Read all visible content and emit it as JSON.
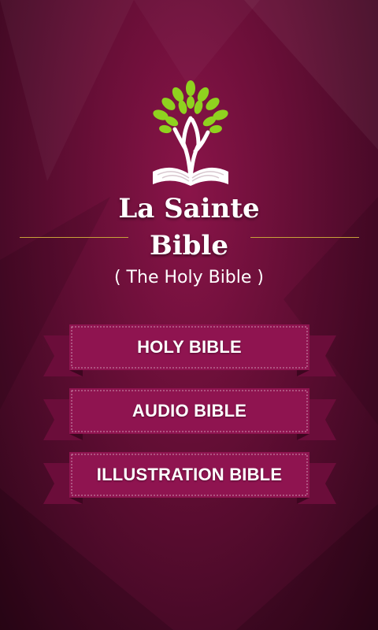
{
  "app": {
    "title_line1": "La Sainte",
    "title_line2": "Bible",
    "subtitle": "( The Holy Bible )",
    "logo_icon": "tree-book-icon"
  },
  "menu": {
    "items": [
      {
        "label": "HOLY BIBLE"
      },
      {
        "label": "AUDIO BIBLE"
      },
      {
        "label": "ILLUSTRATION BIBLE"
      }
    ]
  },
  "colors": {
    "background": "#6a0f38",
    "ribbon": "#8f1450",
    "ribbon_tail": "#6b0d3a",
    "accent_rule": "#c8a23a",
    "leaf": "#8fd21f"
  }
}
